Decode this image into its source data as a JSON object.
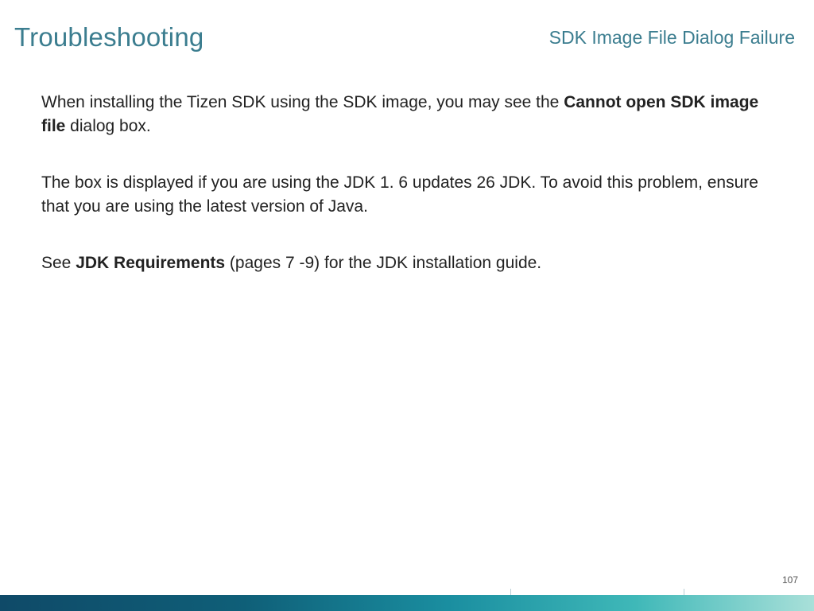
{
  "header": {
    "title": "Troubleshooting",
    "subtitle": "SDK Image File Dialog Failure"
  },
  "body": {
    "p1_a": "When installing the Tizen SDK using the SDK image, you may see the ",
    "p1_b_bold": "Cannot open SDK image file",
    "p1_c": " dialog box.",
    "p2": "The box is displayed if you are using the JDK 1. 6 updates 26 JDK. To avoid this problem, ensure that you are using the latest version of Java.",
    "p3_a": "See ",
    "p3_b_bold": "JDK Requirements",
    "p3_c": " (pages 7 -9) for the JDK installation guide."
  },
  "page_number": "107"
}
